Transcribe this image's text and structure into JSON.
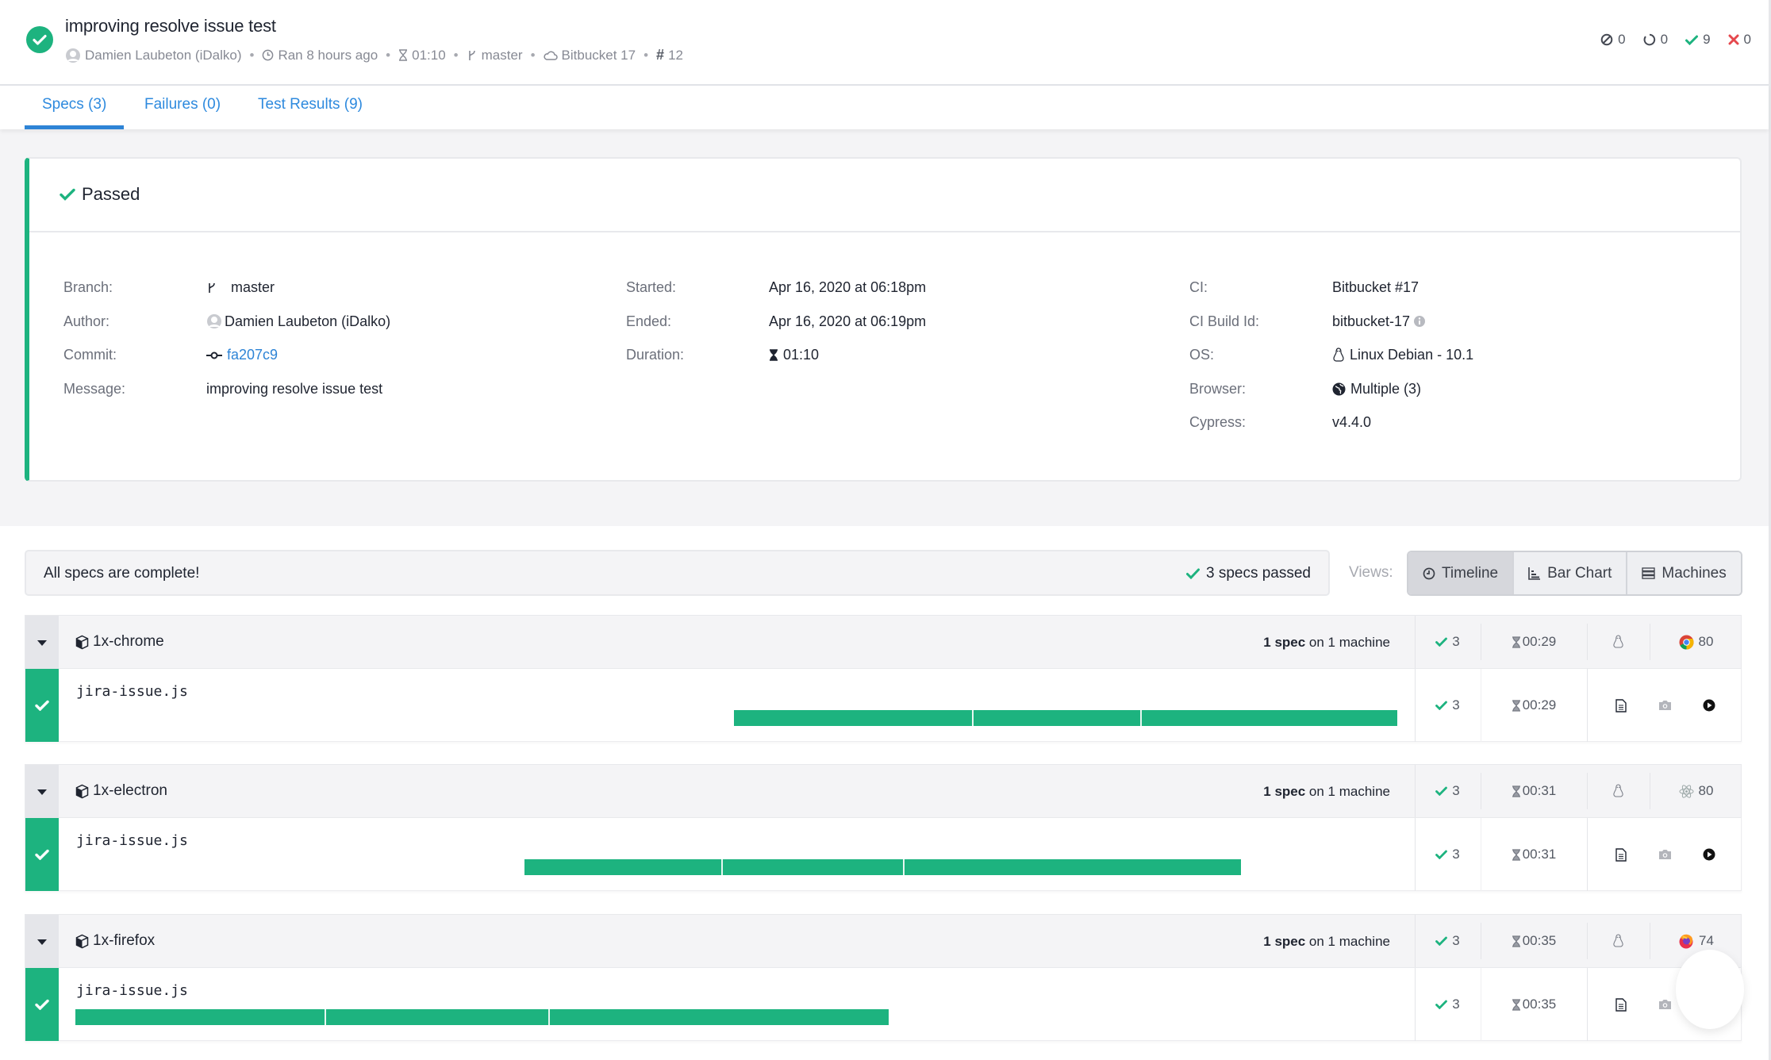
{
  "run": {
    "title": "improving resolve issue test",
    "status": "passed",
    "author": "Damien Laubeton (iDalko)",
    "ran": "Ran 8 hours ago",
    "duration": "01:10",
    "branch": "master",
    "ci": "Bitbucket 17",
    "run_number": "12",
    "counts": {
      "skipped": "0",
      "pending": "0",
      "passed": "9",
      "failed": "0"
    }
  },
  "colors": {
    "success": "#1db37f",
    "link": "#2e84d6",
    "danger": "#e5484d"
  },
  "tabs": [
    {
      "label": "Specs (3)",
      "active": true
    },
    {
      "label": "Failures (0)",
      "active": false
    },
    {
      "label": "Test Results (9)",
      "active": false
    }
  ],
  "summary": {
    "status_label": "Passed",
    "left": [
      {
        "label": "Branch:",
        "value": "master",
        "icon": "branch-icon"
      },
      {
        "label": "Author:",
        "value": "Damien Laubeton (iDalko)",
        "icon": "avatar-icon"
      },
      {
        "label": "Commit:",
        "value": "fa207c9",
        "icon": "commit-icon",
        "link": true
      },
      {
        "label": "Message:",
        "value": "improving resolve issue test"
      }
    ],
    "middle": [
      {
        "label": "Started:",
        "value": "Apr 16, 2020 at 06:18pm"
      },
      {
        "label": "Ended:",
        "value": "Apr 16, 2020 at 06:19pm"
      },
      {
        "label": "Duration:",
        "value": "01:10",
        "icon": "hourglass-icon"
      }
    ],
    "right": [
      {
        "label": "CI:",
        "value": "Bitbucket #17"
      },
      {
        "label": "CI Build Id:",
        "value": "bitbucket-17",
        "icon_after": "info-icon"
      },
      {
        "label": "OS:",
        "value": "Linux Debian - 10.1",
        "icon": "linux-icon"
      },
      {
        "label": "Browser:",
        "value": "Multiple (3)",
        "icon": "globe-icon"
      },
      {
        "label": "Cypress:",
        "value": "v4.4.0"
      }
    ]
  },
  "banner": {
    "message": "All specs are complete!",
    "passed_label": "3 specs passed"
  },
  "views": {
    "label": "Views:",
    "options": [
      {
        "label": "Timeline",
        "icon": "clock-icon",
        "active": true
      },
      {
        "label": "Bar Chart",
        "icon": "bar-chart-icon",
        "active": false
      },
      {
        "label": "Machines",
        "icon": "server-icon",
        "active": false
      }
    ]
  },
  "timeline": {
    "span_seconds": 57.4
  },
  "groups": [
    {
      "name": "1x-chrome",
      "summary_bold": "1 spec",
      "summary_rest": " on 1 machine",
      "passed": "3",
      "duration": "00:29",
      "os_icon": "linux-icon",
      "browser_icon": "chrome-icon",
      "browser_version": "80",
      "spec": {
        "file": "jira-issue.js",
        "passed": "3",
        "duration": "00:29",
        "start_s": 28.6,
        "tests_s": [
          10.4,
          7.3,
          11.1
        ]
      }
    },
    {
      "name": "1x-electron",
      "summary_bold": "1 spec",
      "summary_rest": " on 1 machine",
      "passed": "3",
      "duration": "00:31",
      "os_icon": "linux-icon",
      "browser_icon": "electron-icon",
      "browser_version": "80",
      "spec": {
        "file": "jira-issue.js",
        "passed": "3",
        "duration": "00:31",
        "start_s": 19.5,
        "tests_s": [
          8.6,
          7.9,
          14.6
        ]
      }
    },
    {
      "name": "1x-firefox",
      "summary_bold": "1 spec",
      "summary_rest": " on 1 machine",
      "passed": "3",
      "duration": "00:35",
      "os_icon": "linux-icon",
      "browser_icon": "firefox-icon",
      "browser_version": "74",
      "spec": {
        "file": "jira-issue.js",
        "passed": "3",
        "duration": "00:35",
        "start_s": 0,
        "tests_s": [
          10.9,
          9.7,
          14.7
        ]
      }
    }
  ]
}
